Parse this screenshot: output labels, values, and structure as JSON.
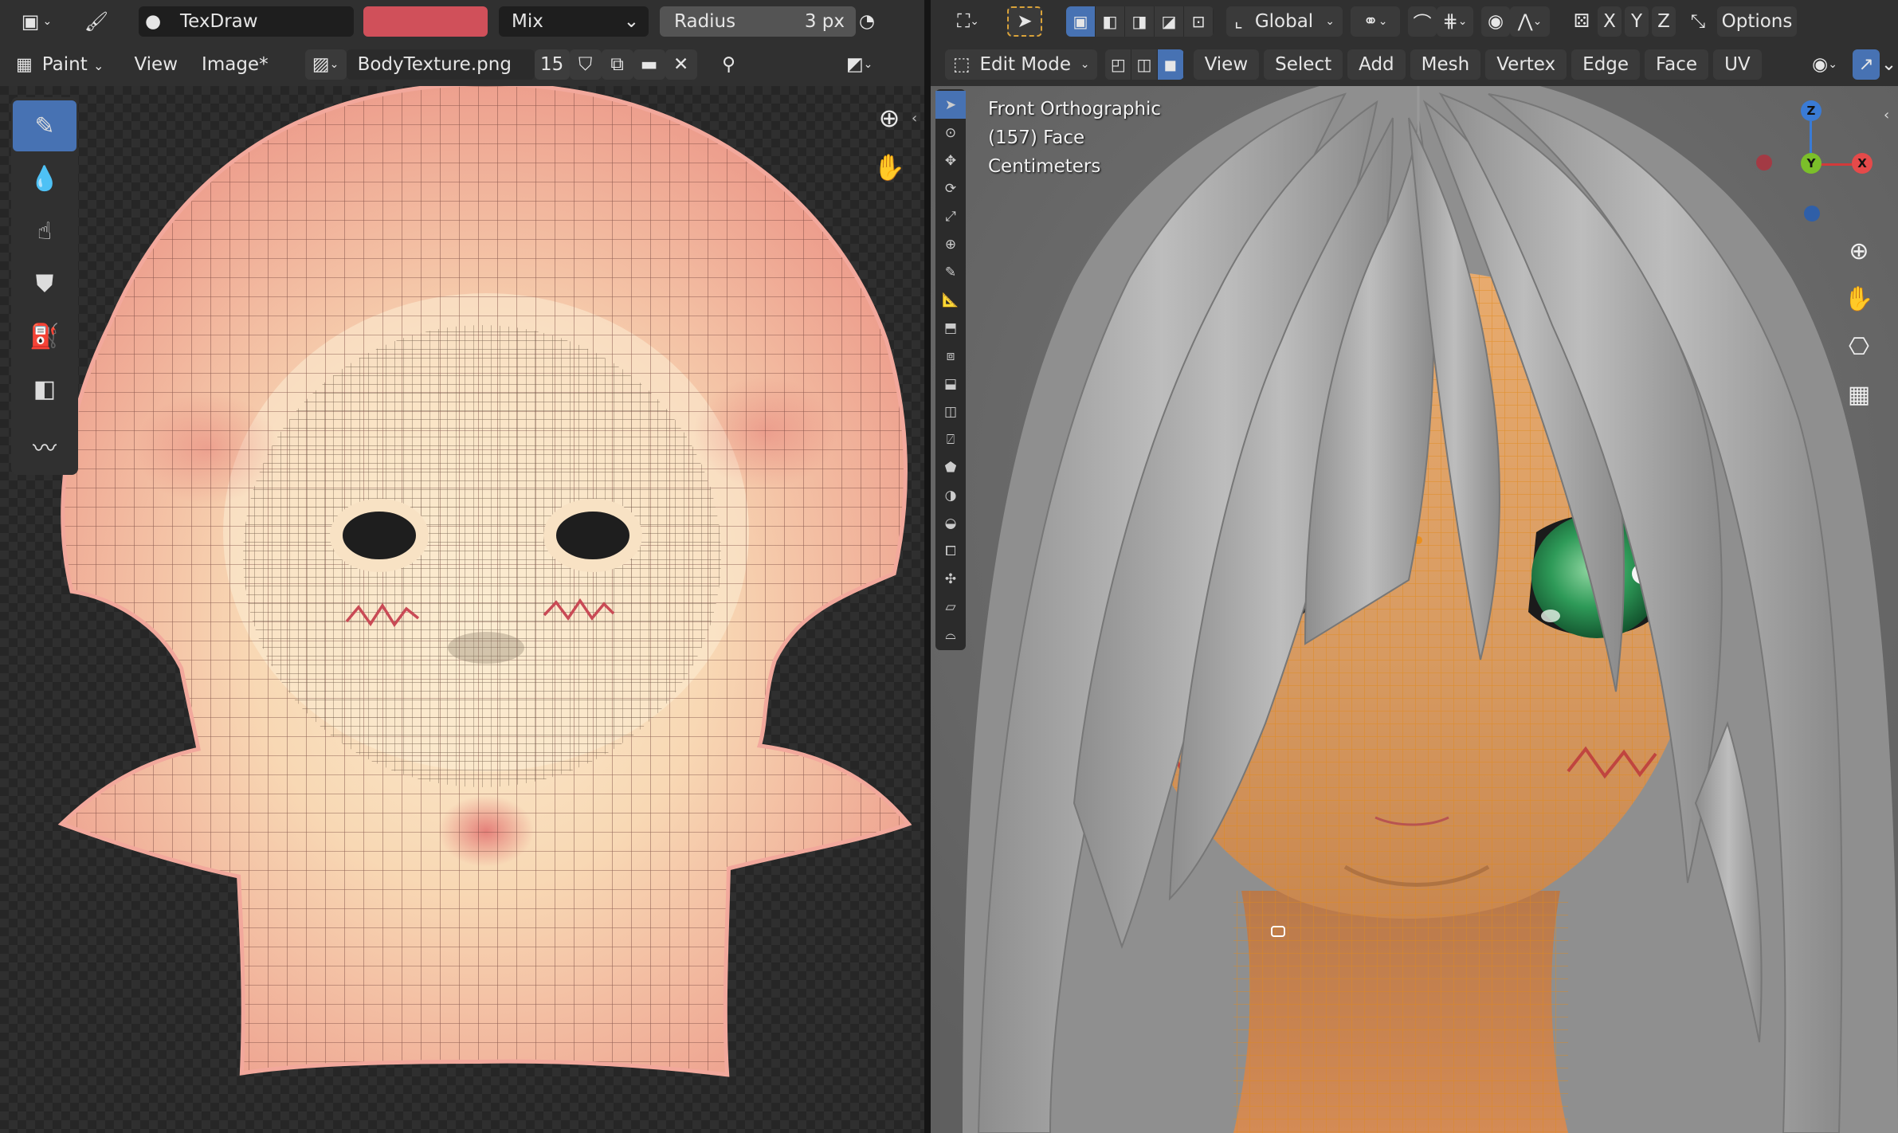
{
  "left_editor": {
    "header_top": {
      "editor_type_icon": "image-editor-icon",
      "brush_icon": "paint-brush-icon",
      "brush_name": "TexDraw",
      "color_swatch": "#d0505a",
      "blend_mode": "Mix",
      "radius_label": "Radius",
      "radius_value": "3 px"
    },
    "header_menu": {
      "mode": "Paint",
      "view": "View",
      "image": "Image*",
      "image_name": "BodyTexture.png",
      "users_count": "15"
    },
    "tools": [
      "brush-tool",
      "soften-tool",
      "smear-tool",
      "clone-tool",
      "fill-tool",
      "mask-tool",
      "annotate-tool"
    ]
  },
  "right_editor": {
    "header_top": {
      "transform_orientation": "Global",
      "axis_x": "X",
      "axis_y": "Y",
      "axis_z": "Z",
      "options_label": "Options"
    },
    "header_menu": {
      "mode": "Edit Mode",
      "items": [
        "View",
        "Select",
        "Add",
        "Mesh",
        "Vertex",
        "Edge",
        "Face",
        "UV"
      ]
    },
    "overlay": {
      "view_name": "Front Orthographic",
      "object_info": "(157) Face",
      "units": "Centimeters"
    },
    "gizmo": {
      "z": "Z",
      "y": "Y",
      "x": "X"
    }
  }
}
